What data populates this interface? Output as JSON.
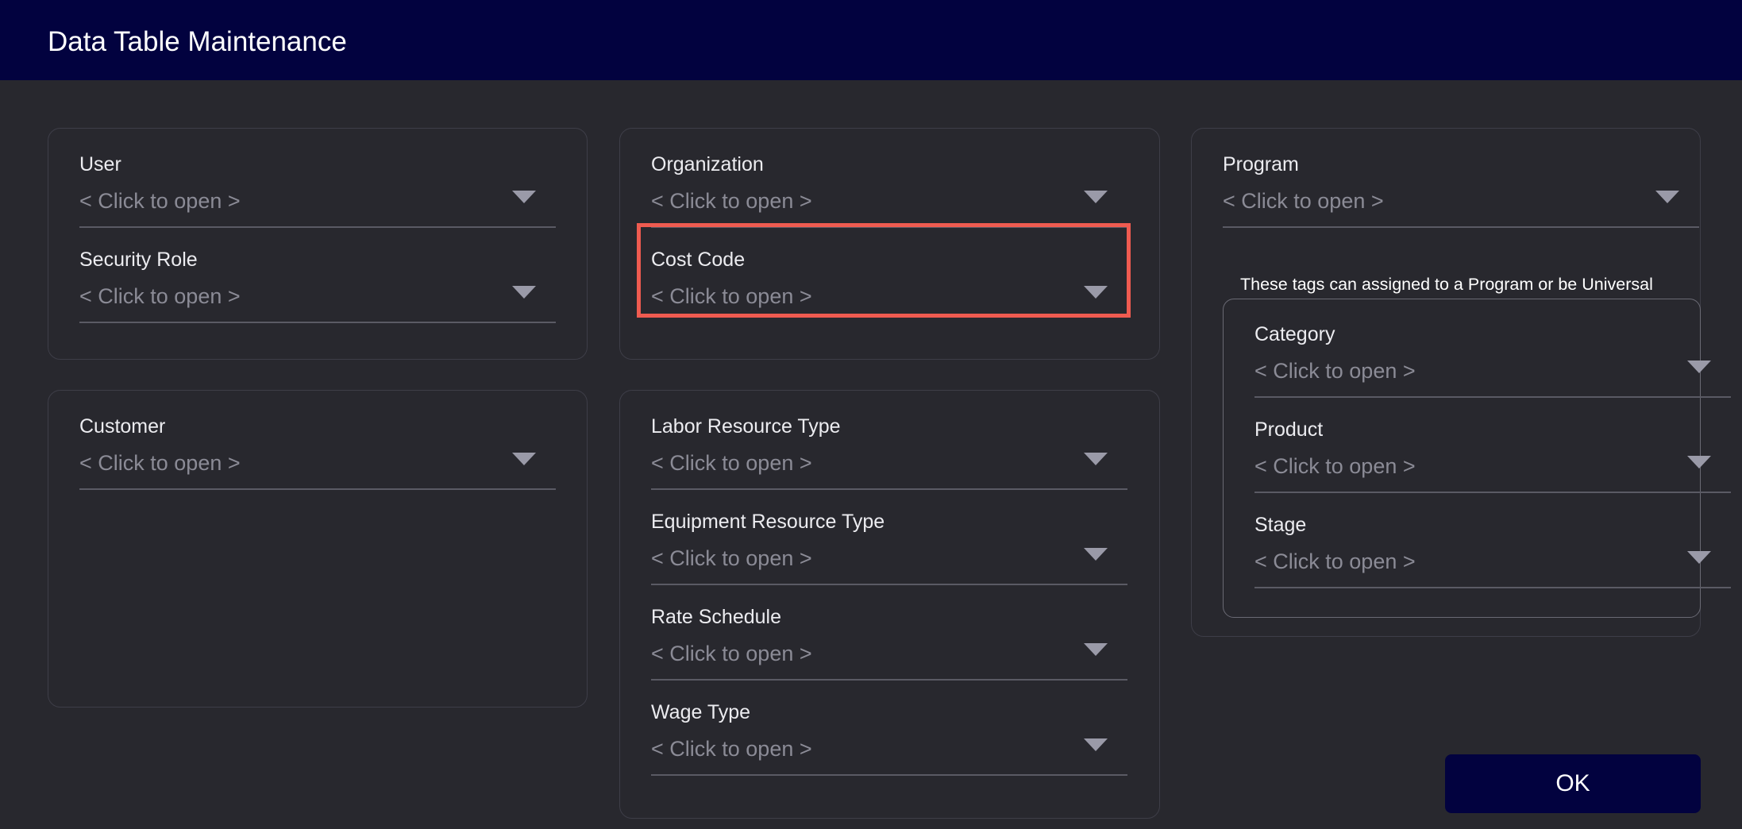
{
  "window": {
    "title": "Data Table Maintenance"
  },
  "left_panel_top": {
    "fields": [
      {
        "label": "User",
        "value": "< Click to open >"
      },
      {
        "label": "Security Role",
        "value": "< Click to open >"
      }
    ]
  },
  "left_panel_bottom": {
    "fields": [
      {
        "label": "Customer",
        "value": "< Click to open >"
      }
    ]
  },
  "middle_panel_top": {
    "fields": [
      {
        "label": "Organization",
        "value": "< Click to open >"
      },
      {
        "label": "Cost Code",
        "value": "< Click to open >",
        "highlighted": true
      }
    ]
  },
  "middle_panel_bottom": {
    "fields": [
      {
        "label": "Labor Resource Type",
        "value": "< Click to open >"
      },
      {
        "label": "Equipment Resource Type",
        "value": "< Click to open >"
      },
      {
        "label": "Rate Schedule",
        "value": "< Click to open >"
      },
      {
        "label": "Wage Type",
        "value": "< Click to open >"
      }
    ]
  },
  "right_panel": {
    "fields": [
      {
        "label": "Program",
        "value": "< Click to open >"
      }
    ],
    "tags_note": "These tags can assigned to a Program or be Universal",
    "tags": [
      {
        "label": "Category",
        "value": "< Click to open >"
      },
      {
        "label": "Product",
        "value": "< Click to open >"
      },
      {
        "label": "Stage",
        "value": "< Click to open >"
      }
    ]
  },
  "footer": {
    "ok_label": "OK"
  },
  "colors": {
    "titlebar": "#02023f",
    "background": "#28282e",
    "highlight": "#ef5b50",
    "ok_button": "#02023f"
  },
  "icons": {
    "dropdown": "chevron-down-icon"
  }
}
